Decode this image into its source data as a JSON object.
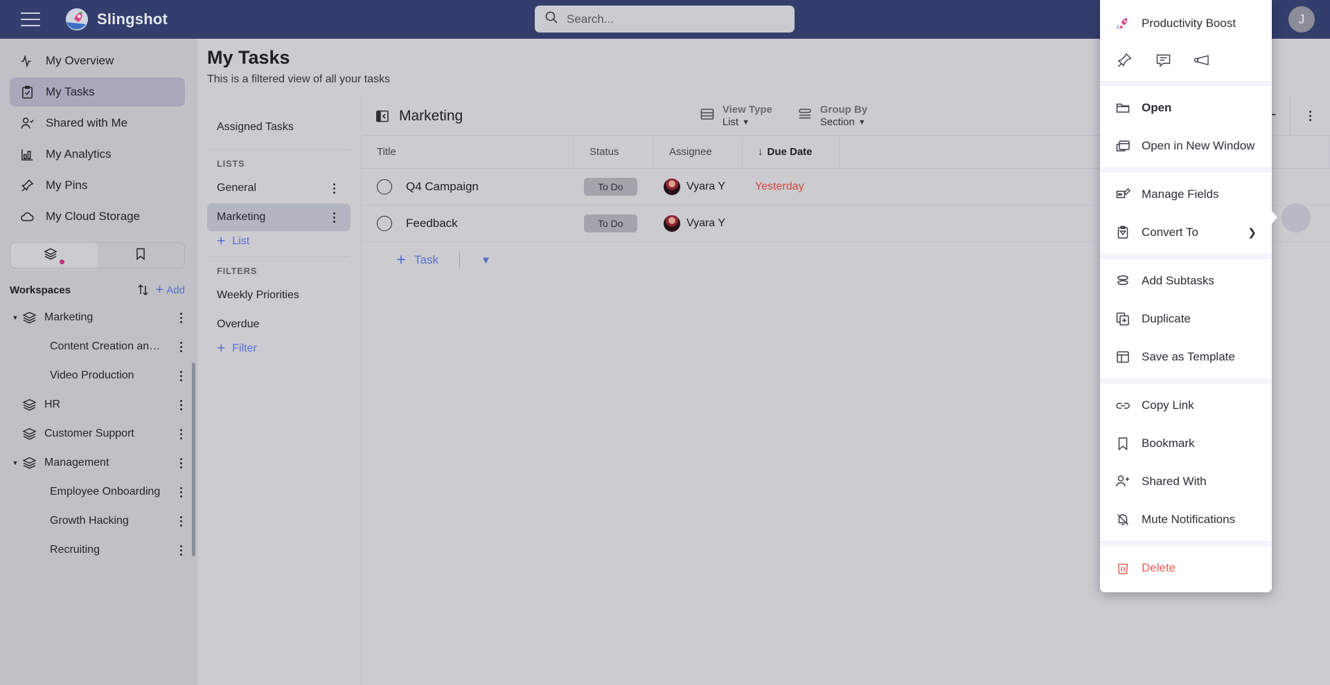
{
  "topbar": {
    "brand": "Slingshot",
    "search_placeholder": "Search...",
    "avatar_initial": "J"
  },
  "sidebar": {
    "nav": [
      {
        "label": "My Overview",
        "icon": "activity-icon",
        "active": false
      },
      {
        "label": "My Tasks",
        "icon": "clipboard-check-icon",
        "active": true
      },
      {
        "label": "Shared with Me",
        "icon": "user-check-icon",
        "active": false
      },
      {
        "label": "My Analytics",
        "icon": "bar-chart-icon",
        "active": false
      },
      {
        "label": "My Pins",
        "icon": "pin-icon",
        "active": false
      },
      {
        "label": "My Cloud Storage",
        "icon": "cloud-icon",
        "active": false
      }
    ],
    "tabs": [
      {
        "name": "workspaces-tab",
        "icon": "layers-icon",
        "selected": true
      },
      {
        "name": "bookmarks-tab",
        "icon": "bookmark-icon",
        "selected": false
      }
    ],
    "workspaces_title": "Workspaces",
    "sort_icon": "sort-arrows-icon",
    "add_label": "Add",
    "tree": [
      {
        "label": "Marketing",
        "level": 0,
        "expanded": true
      },
      {
        "label": "Content Creation an…",
        "level": 1
      },
      {
        "label": "Video Production",
        "level": 1
      },
      {
        "label": "HR",
        "level": 0,
        "expanded": false
      },
      {
        "label": "Customer Support",
        "level": 0,
        "expanded": false
      },
      {
        "label": "Management",
        "level": 0,
        "expanded": true
      },
      {
        "label": "Employee Onboarding",
        "level": 1
      },
      {
        "label": "Growth Hacking",
        "level": 1
      },
      {
        "label": "Recruiting",
        "level": 1
      }
    ]
  },
  "page": {
    "title": "My Tasks",
    "subtitle": "This is a filtered view of all your tasks"
  },
  "list_panel": {
    "assigned_tasks": "Assigned Tasks",
    "lists_caption": "LISTS",
    "lists": [
      {
        "label": "General",
        "selected": false
      },
      {
        "label": "Marketing",
        "selected": true
      }
    ],
    "add_list": "List",
    "filters_caption": "FILTERS",
    "filters": [
      {
        "label": "Weekly Priorities"
      },
      {
        "label": "Overdue"
      }
    ],
    "add_filter": "Filter"
  },
  "task_panel": {
    "title": "Marketing",
    "collapse_icon": "collapse-panel-icon",
    "view_type": {
      "key": "View Type",
      "value": "List"
    },
    "group_by": {
      "key": "Group By",
      "value": "Section"
    },
    "filter_icon": "filter-icon",
    "add_icon": "plus-icon",
    "kebab_icon": "kebab-menu-icon",
    "columns": [
      "Title",
      "Status",
      "Assignee",
      "Due Date"
    ],
    "sorted_column": "Due Date",
    "sort_direction": "↓",
    "rows": [
      {
        "title": "Q4 Campaign",
        "status": "To Do",
        "assignee": "Vyara Y",
        "due": "Yesterday",
        "due_overdue": true
      },
      {
        "title": "Feedback",
        "status": "To Do",
        "assignee": "Vyara Y",
        "due": "",
        "due_overdue": false
      }
    ],
    "add_task": "Task"
  },
  "context_menu": {
    "promo": {
      "label": "Productivity Boost",
      "icon": "rocket-icon"
    },
    "quick_icons": [
      {
        "name": "pin-icon"
      },
      {
        "name": "comment-icon"
      },
      {
        "name": "megaphone-icon"
      }
    ],
    "items": [
      {
        "label": "Open",
        "icon": "folder-open-icon",
        "bold": true
      },
      {
        "label": "Open in New Window",
        "icon": "new-window-icon"
      },
      {
        "separator": true
      },
      {
        "label": "Manage Fields",
        "icon": "manage-fields-icon"
      },
      {
        "label": "Convert To",
        "icon": "convert-icon",
        "submenu": true
      },
      {
        "separator": true
      },
      {
        "label": "Add Subtasks",
        "icon": "subtasks-icon"
      },
      {
        "label": "Duplicate",
        "icon": "duplicate-icon"
      },
      {
        "label": "Save as Template",
        "icon": "template-icon"
      },
      {
        "separator": true
      },
      {
        "label": "Copy Link",
        "icon": "link-icon"
      },
      {
        "label": "Bookmark",
        "icon": "bookmark-icon"
      },
      {
        "label": "Shared With",
        "icon": "user-plus-icon"
      },
      {
        "label": "Mute Notifications",
        "icon": "bell-off-icon"
      },
      {
        "separator": true
      },
      {
        "label": "Delete",
        "icon": "trash-icon",
        "danger": true
      }
    ]
  },
  "colors": {
    "topbar": "#343e6d",
    "accent_blue": "#5a6fd0",
    "accent_pink": "#c2337a",
    "danger": "#ed5b54",
    "overdue": "#d4453f"
  }
}
